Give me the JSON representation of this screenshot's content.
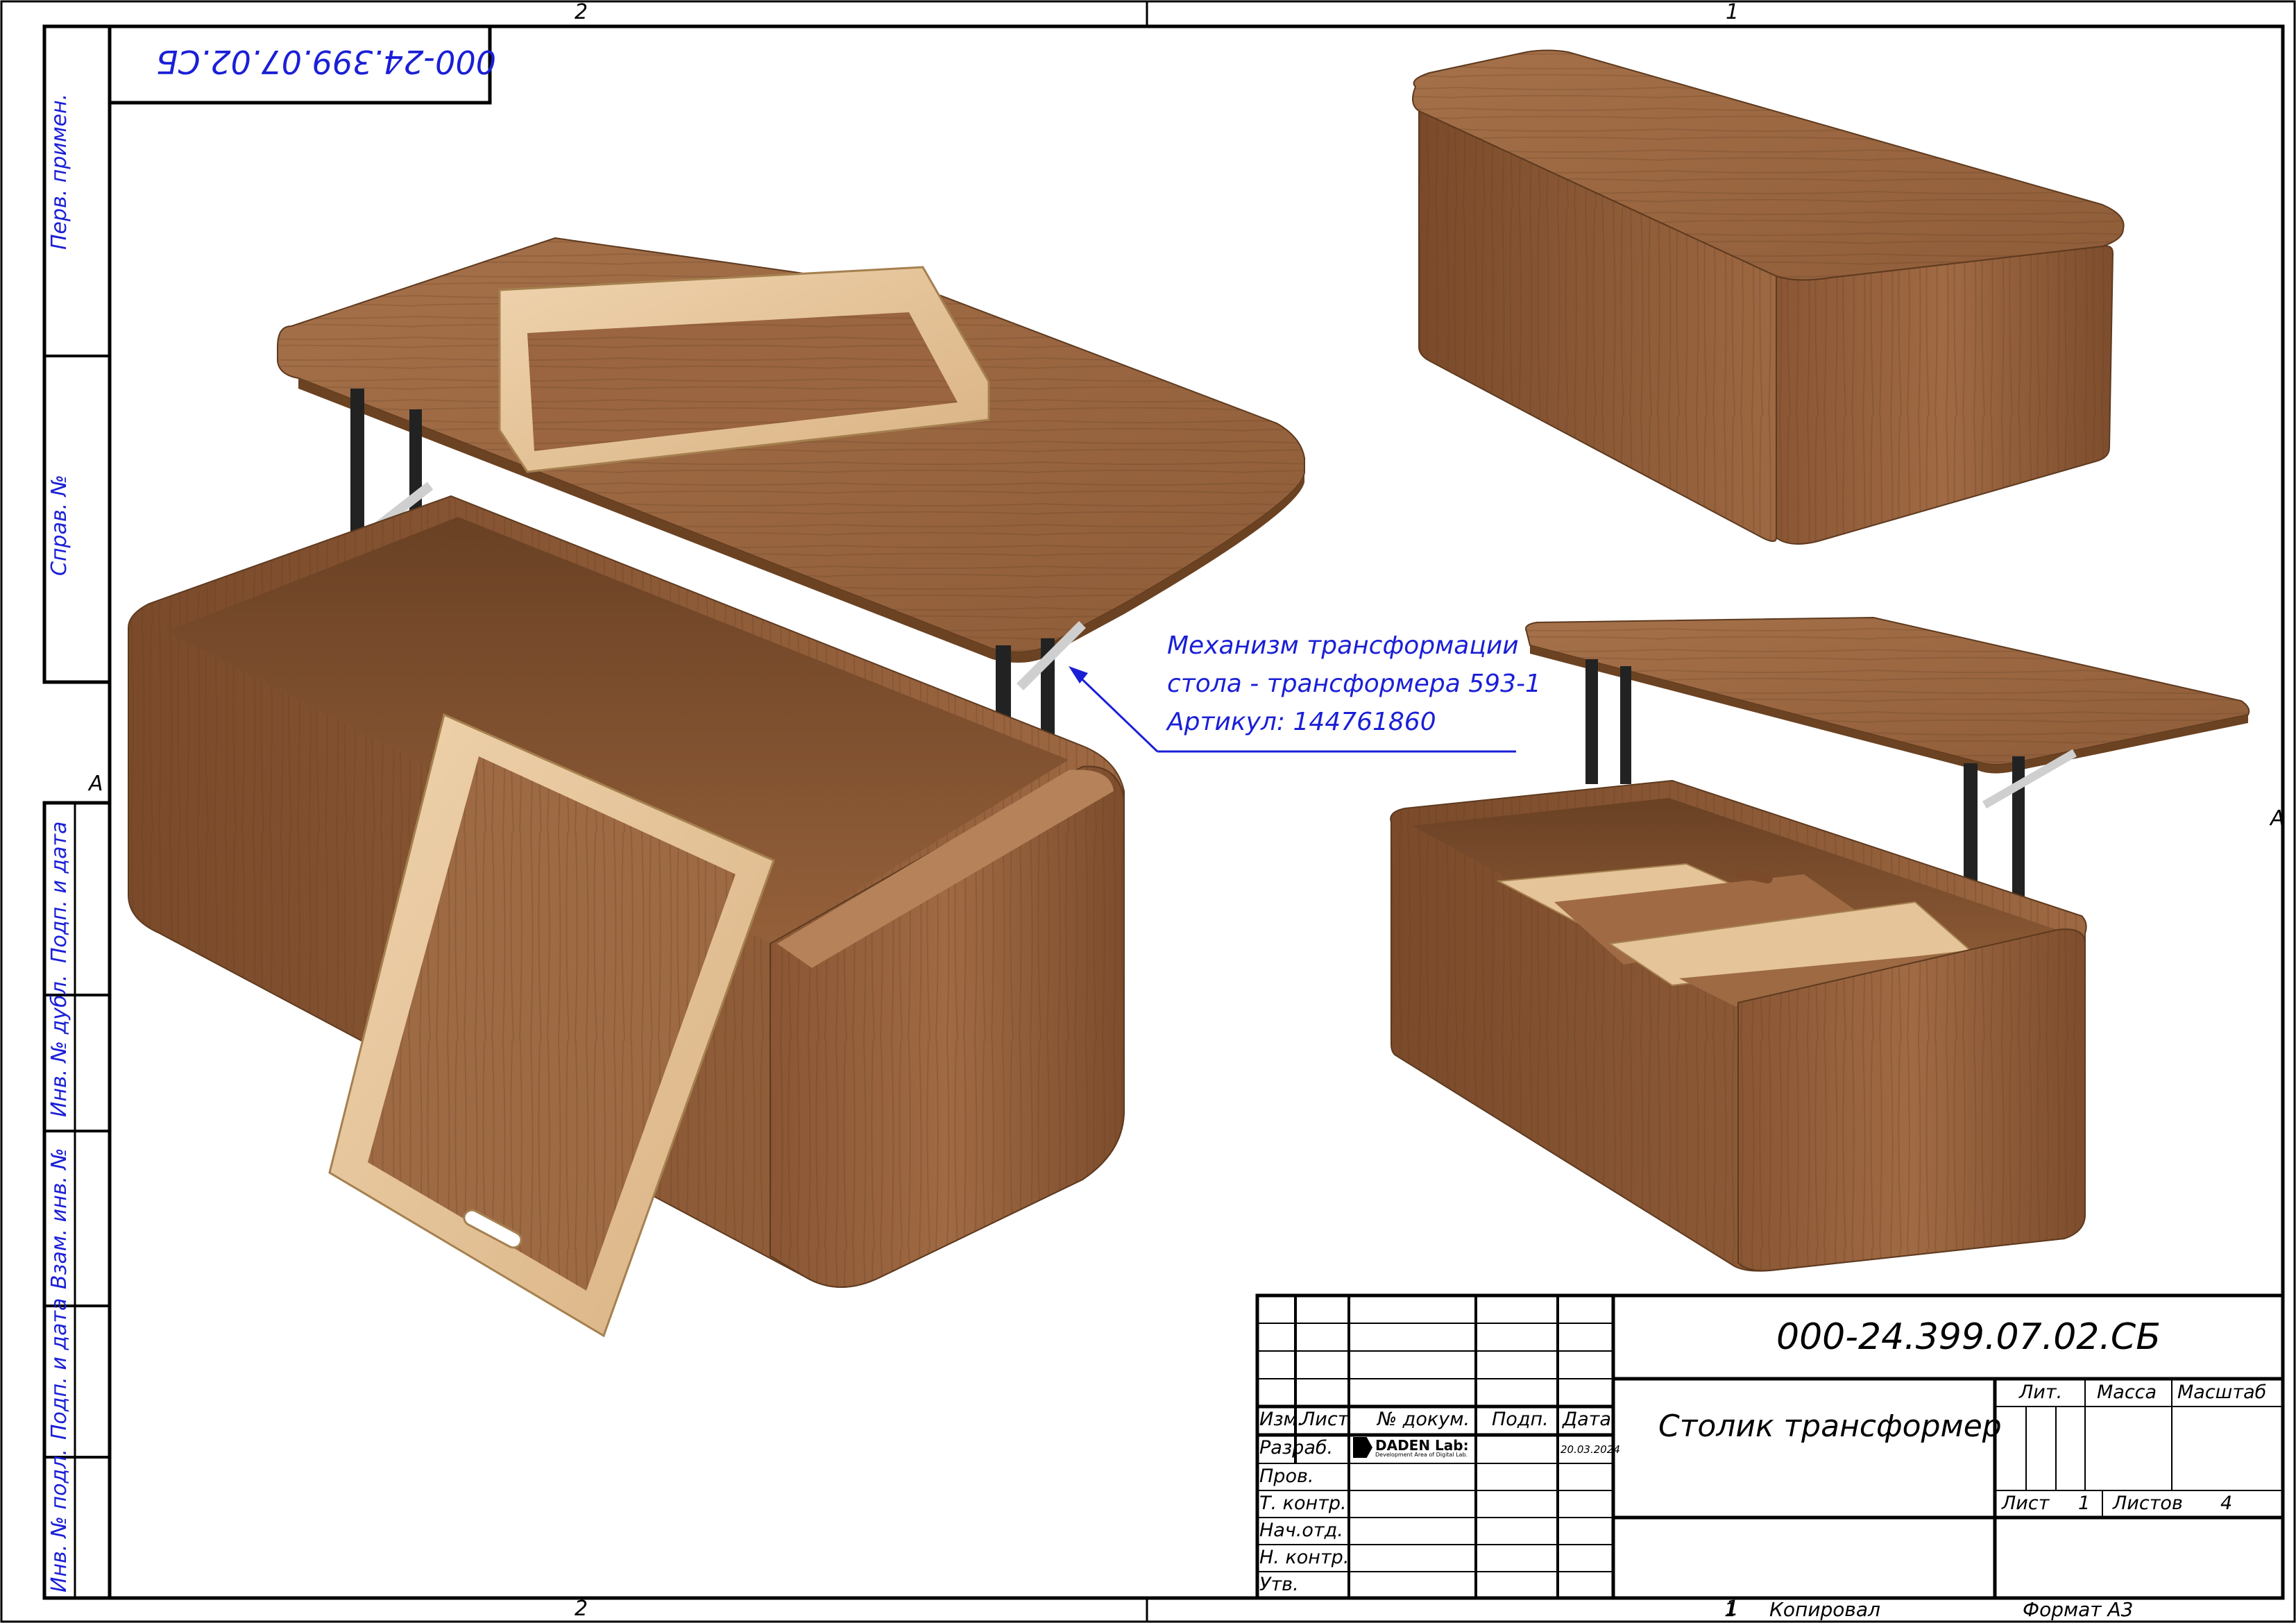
{
  "document": {
    "designation": "000-24.399.07.02.СБ",
    "designation_mirrored": "000-24.399.07.02.СБ",
    "title": "Столик трансформер",
    "format_label": "Формат А3",
    "copied_label": "Копировал",
    "copied_num": "1"
  },
  "zones": {
    "top_left": "2",
    "top_right": "1",
    "bottom_left": "2",
    "bottom_right": "1",
    "left_a": "A",
    "right_a": "A"
  },
  "side_column": {
    "perv_primen": "Перв. примен.",
    "sprav_no": "Справ. №",
    "podp_data_1": "Подп. и дата",
    "inv_dubl": "Инв. № дубл.",
    "vzam_inv": "Взам. инв. №",
    "podp_data_2": "Подп. и дата",
    "inv_podl": "Инв. № подл."
  },
  "annotation": {
    "line1": "Механизм трансформации",
    "line2": "стола - трансформера 593-1",
    "line3": "Артикул: 144761860"
  },
  "title_block": {
    "header": {
      "izm": "Изм.",
      "list": "Лист",
      "doc_no": "№ докум.",
      "podp": "Подп.",
      "data": "Дата"
    },
    "roles": [
      "Разраб.",
      "Пров.",
      "Т. контр.",
      "Нач.отд.",
      "Н. контр.",
      "Утв."
    ],
    "developer_logo": "DADEN Lab:",
    "developer_logo_sub": "Development Area of Digital Lab.",
    "date": "20.03.2024",
    "lit_label": "Лит.",
    "mass_label": "Масса",
    "scale_label": "Масштаб",
    "sheet_label": "Лист",
    "sheet_value": "1",
    "sheets_label": "Листов",
    "sheets_value": "4"
  },
  "colors": {
    "line": "#000000",
    "annotation": "#1a1fd6",
    "wood_mid": "#9a6540",
    "wood_dark": "#6e4426",
    "wood_light": "#b07a50",
    "tray_birch": "#e5c49a",
    "metal": "#2a2a2a"
  },
  "illustrations": [
    {
      "name": "table-open-with-tray-render"
    },
    {
      "name": "table-closed-render"
    },
    {
      "name": "table-open-compartments-render"
    }
  ]
}
